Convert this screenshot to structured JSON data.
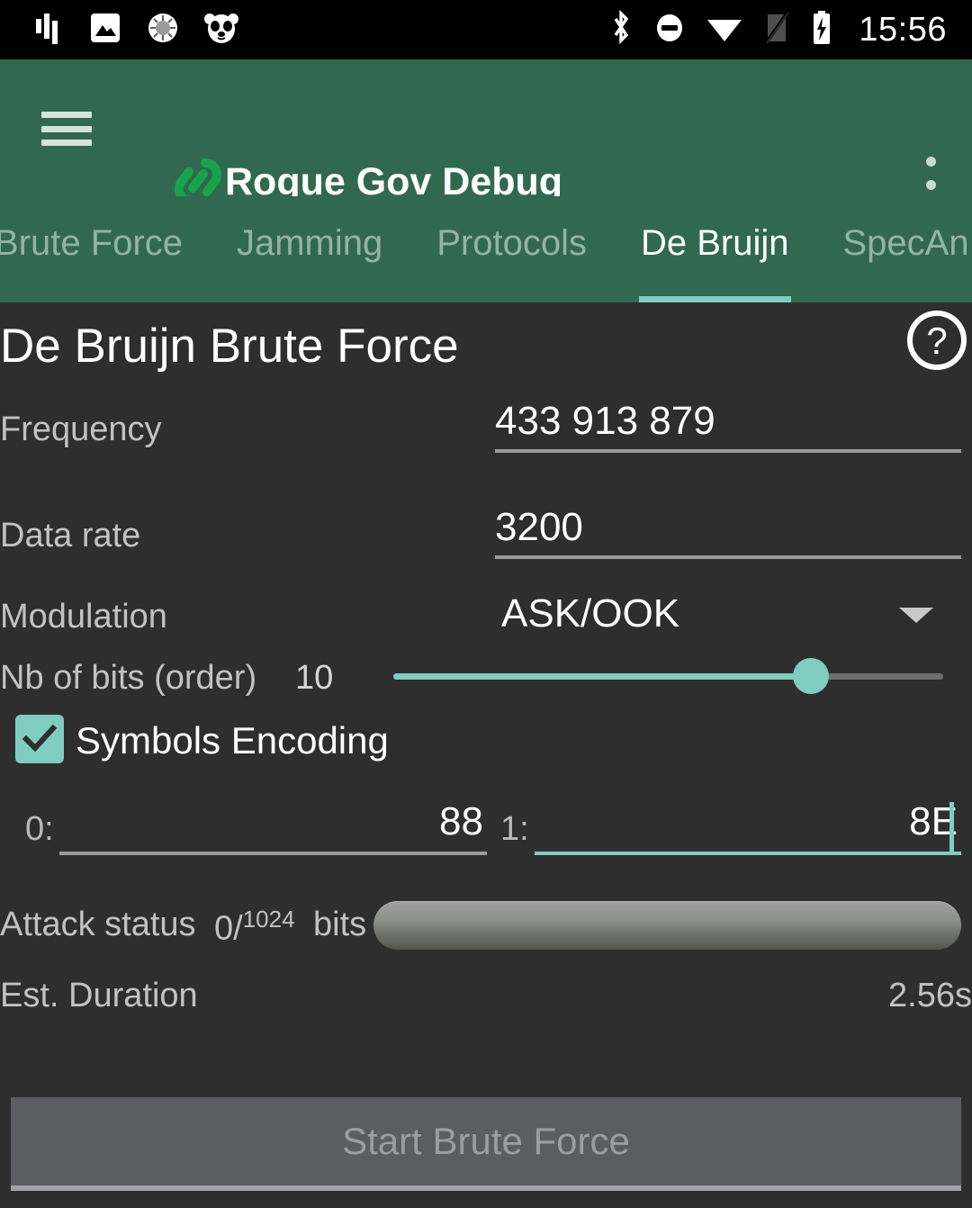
{
  "statusbar": {
    "time": "15:56",
    "left_icons": [
      "equalizer-icon",
      "image-icon",
      "loading-spinner-icon",
      "panda-icon"
    ],
    "right_icons": [
      "bluetooth-icon",
      "do-not-disturb-icon",
      "wifi-icon",
      "sim-off-icon",
      "battery-charging-icon"
    ]
  },
  "appbar": {
    "menu_icon": "hamburger-menu-icon",
    "logo_icon": "chain-link-icon",
    "title": "Rogue Gov Debug",
    "overflow_icon": "more-vertical-icon",
    "background": "#30694f"
  },
  "tabs": [
    {
      "label": "Brute Force",
      "active": false
    },
    {
      "label": "Jamming",
      "active": false
    },
    {
      "label": "Protocols",
      "active": false
    },
    {
      "label": "De Bruijn",
      "active": true
    },
    {
      "label": "SpecAn",
      "active": false
    }
  ],
  "page": {
    "title": "De Bruijn Brute Force",
    "help_icon": "help-circle-icon",
    "accent": "#7ecdc0"
  },
  "fields": {
    "frequency": {
      "label": "Frequency",
      "value": "433 913 879"
    },
    "data_rate": {
      "label": "Data rate",
      "value": "3200"
    },
    "modulation": {
      "label": "Modulation",
      "value": "ASK/OOK",
      "caret_icon": "chevron-down-icon"
    },
    "nb_of_bits": {
      "label": "Nb of bits (order)",
      "value": "10",
      "slider_percent": 76
    },
    "symbols_encoding": {
      "label": "Symbols Encoding",
      "checked": true
    },
    "symbol_zero": {
      "label": "0:",
      "value": "88",
      "focused": false
    },
    "symbol_one": {
      "label": "1:",
      "value": "8E",
      "focused": true
    }
  },
  "status": {
    "attack_label": "Attack status",
    "attack_current": "0/",
    "attack_total": "1024",
    "attack_unit": "bits",
    "progress_percent": 0,
    "duration_label": "Est. Duration",
    "duration_value": "2.56s"
  },
  "actions": {
    "start_label": "Start Brute Force"
  }
}
